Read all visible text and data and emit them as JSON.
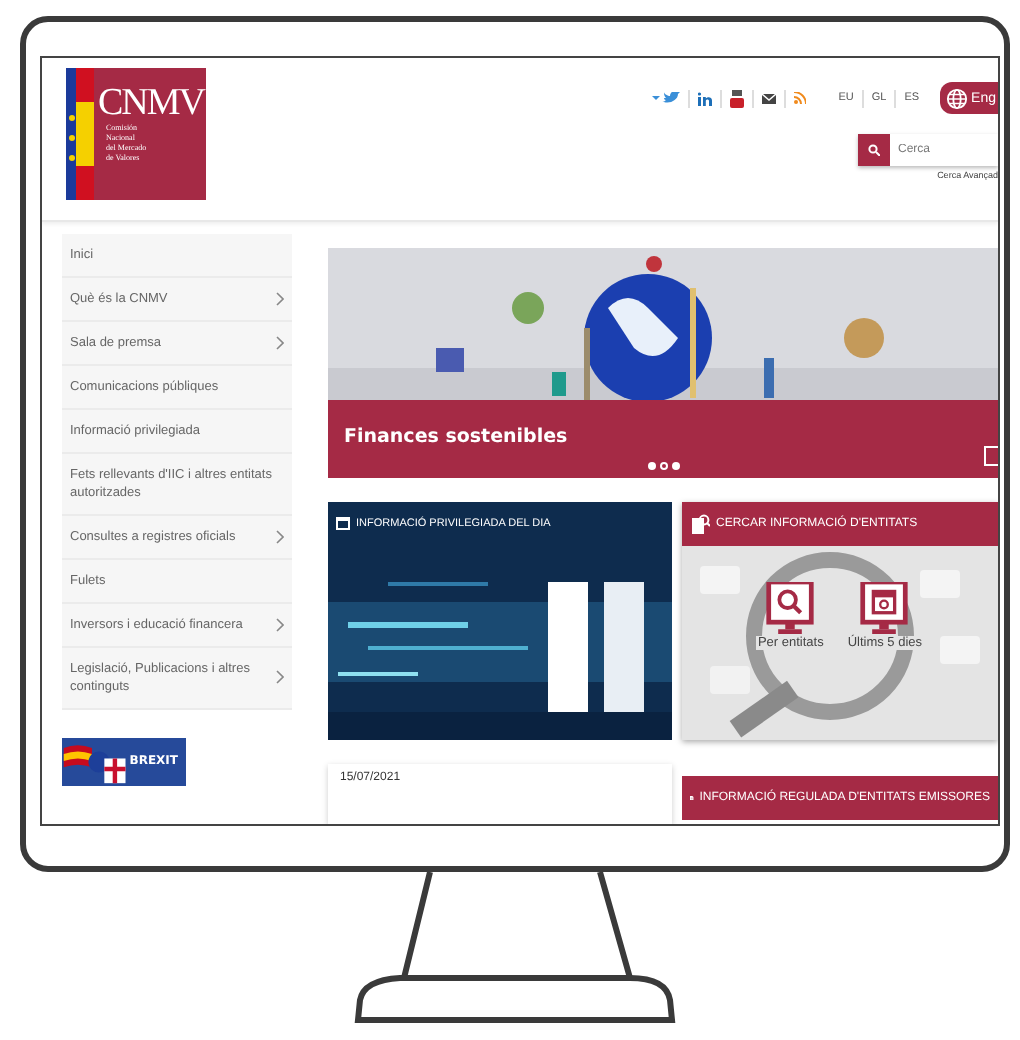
{
  "logo": {
    "title": "CNMV",
    "subtitle": [
      "Comisión",
      "Nacional",
      "del Mercado",
      "de Valores"
    ]
  },
  "languages": [
    {
      "label": "EU"
    },
    {
      "label": "GL"
    },
    {
      "label": "ES"
    }
  ],
  "english_button": "Eng",
  "search": {
    "placeholder": "Cerca"
  },
  "advanced_search": "Cerca Avançad",
  "menu": [
    {
      "label": "Inici",
      "expandable": false
    },
    {
      "label": "Què és la CNMV",
      "expandable": true
    },
    {
      "label": "Sala de premsa",
      "expandable": true
    },
    {
      "label": "Comunicacions públiques",
      "expandable": false
    },
    {
      "label": "Informació privilegiada",
      "expandable": false
    },
    {
      "label": "Fets rellevants d'IIC i altres entitats autoritzades",
      "expandable": false
    },
    {
      "label": "Consultes a registres oficials",
      "expandable": true
    },
    {
      "label": "Fulets",
      "expandable": false
    },
    {
      "label": "Inversors i educació financera",
      "expandable": true
    },
    {
      "label": "Legislació, Publicacions i altres continguts",
      "expandable": true
    }
  ],
  "brexit_banner": "BREXIT",
  "slider": {
    "caption": "Finances sostenibles",
    "dots": [
      {
        "selected": false
      },
      {
        "selected": true
      },
      {
        "selected": false
      }
    ]
  },
  "privileged_info": {
    "title": "INFORMACIÓ PRIVILEGIADA DEL DIA",
    "date": "15/07/2021"
  },
  "entity_search": {
    "title": "CERCAR INFORMACIÓ D'ENTITATS",
    "buttons": [
      "Per entitats",
      "Últims 5 dies"
    ]
  },
  "regulated_info": {
    "title": "INFORMACIÓ REGULADA D'ENTITATS EMISSORES"
  }
}
